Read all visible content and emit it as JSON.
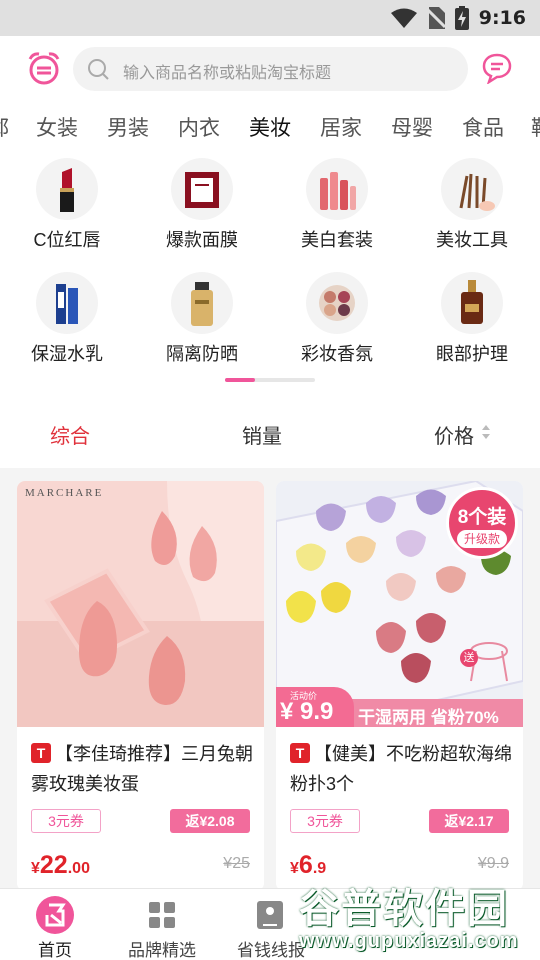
{
  "status_bar": {
    "time": "9:16"
  },
  "header": {
    "search_placeholder": "输入商品名称或粘贴淘宝标题",
    "logo_icon": "alarm-clock-logo-icon",
    "message_icon": "chat-bubble-icon"
  },
  "categories": [
    "鄣",
    "女装",
    "男装",
    "内衣",
    "美妆",
    "居家",
    "母婴",
    "食品",
    "鞋"
  ],
  "active_category": "美妆",
  "subcategories": [
    {
      "label": "C位红唇",
      "icon": "lipstick-icon"
    },
    {
      "label": "爆款面膜",
      "icon": "face-mask-box-icon"
    },
    {
      "label": "美白套装",
      "icon": "skincare-set-icon"
    },
    {
      "label": "美妆工具",
      "icon": "makeup-brushes-icon"
    },
    {
      "label": "保湿水乳",
      "icon": "lotion-bottle-icon"
    },
    {
      "label": "隔离防晒",
      "icon": "sunscreen-icon"
    },
    {
      "label": "彩妆香氛",
      "icon": "eyeshadow-palette-icon"
    },
    {
      "label": "眼部护理",
      "icon": "serum-bottle-icon"
    }
  ],
  "sort": {
    "comprehensive": "综合",
    "sales": "销量",
    "price": "价格",
    "active": "综合"
  },
  "products": [
    {
      "brand_text": "MARCHARE",
      "tag": "T",
      "title": "【李佳琦推荐】三月兔朝雾玫瑰美妆蛋",
      "coupon": "3元券",
      "rebate": "返¥2.08",
      "price_symbol": "¥",
      "price_int": "22",
      "price_dec": ".00",
      "original_price": "¥25",
      "accent_color": "#f3c4bf"
    },
    {
      "badge_main": "8个装",
      "badge_sub": "升级款",
      "promo_label": "活动价",
      "promo_price": "¥ 9.9",
      "promo_text": "干湿两用 省粉70%",
      "gift_label": "送",
      "tag": "T",
      "title": "【健美】不吃粉超软海绵粉扑3个",
      "coupon": "3元券",
      "rebate": "返¥2.17",
      "price_symbol": "¥",
      "price_int": "6",
      "price_dec": ".9",
      "original_price": "¥9.9",
      "accent_color": "#e8466f"
    }
  ],
  "tabbar": [
    {
      "label": "首页",
      "icon": "rebate-home-icon",
      "active": true
    },
    {
      "label": "品牌精选",
      "icon": "grid-squares-icon",
      "active": false
    },
    {
      "label": "省钱线报",
      "icon": "coupon-bag-icon",
      "active": false
    }
  ],
  "watermark": {
    "title": "谷普软件园",
    "url": "www.gupuxiazai.com"
  },
  "colors": {
    "accent": "#f0559a",
    "price": "#e0232a",
    "active_sort": "#e0323c"
  }
}
